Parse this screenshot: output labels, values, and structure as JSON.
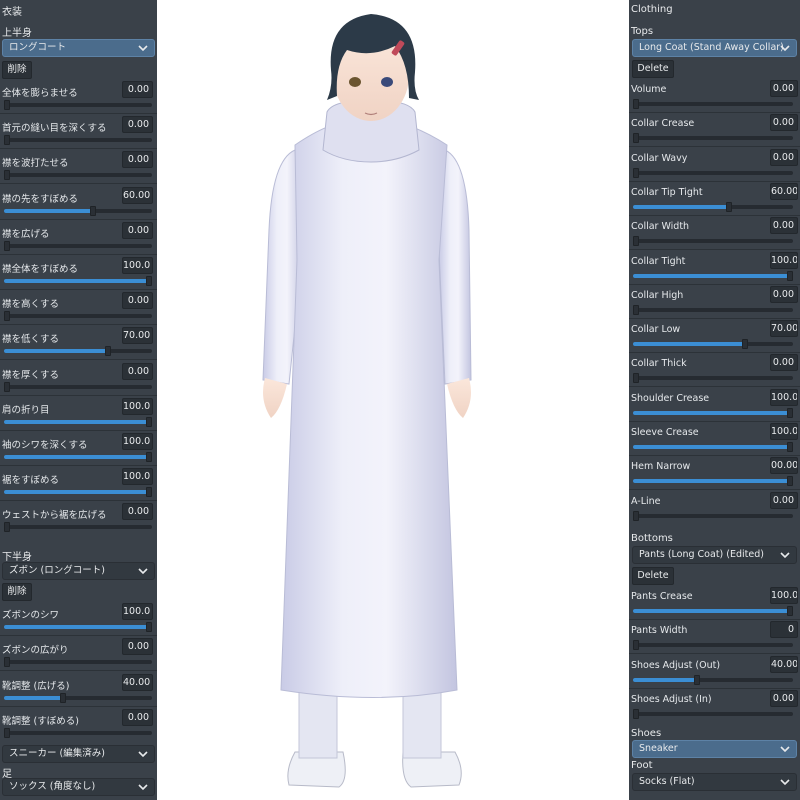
{
  "left": {
    "header": "衣装",
    "tops_label": "上半身",
    "tops_dropdown": "ロングコート",
    "delete_label": "削除",
    "top_sliders": [
      {
        "label": "全体を膨らませる",
        "value": "0.00",
        "fraction": 0
      },
      {
        "label": "首元の縫い目を深くする",
        "value": "0.00",
        "fraction": 0
      },
      {
        "label": "襟を波打たせる",
        "value": "0.00",
        "fraction": 0
      },
      {
        "label": "襟の先をすぼめる",
        "value": "60.00",
        "fraction": 0.6
      },
      {
        "label": "襟を広げる",
        "value": "0.00",
        "fraction": 0
      },
      {
        "label": "襟全体をすぼめる",
        "value": "100.0",
        "fraction": 1
      },
      {
        "label": "襟を高くする",
        "value": "0.00",
        "fraction": 0
      },
      {
        "label": "襟を低くする",
        "value": "70.00",
        "fraction": 0.7
      },
      {
        "label": "襟を厚くする",
        "value": "0.00",
        "fraction": 0
      },
      {
        "label": "肩の折り目",
        "value": "100.0",
        "fraction": 1
      },
      {
        "label": "袖のシワを深くする",
        "value": "100.0",
        "fraction": 1
      },
      {
        "label": "裾をすぼめる",
        "value": "100.0",
        "fraction": 1
      },
      {
        "label": "ウェストから裾を広げる",
        "value": "0.00",
        "fraction": 0
      }
    ],
    "bottoms_label": "下半身",
    "bottoms_dropdown": "ズボン (ロングコート)",
    "bottoms_delete_label": "削除",
    "bottom_sliders": [
      {
        "label": "ズボンのシワ",
        "value": "100.0",
        "fraction": 1
      },
      {
        "label": "ズボンの広がり",
        "value": "0.00",
        "fraction": 0
      },
      {
        "label": "靴調整 (広げる)",
        "value": "40.00",
        "fraction": 0.4
      },
      {
        "label": "靴調整 (すぼめる)",
        "value": "0.00",
        "fraction": 0
      }
    ],
    "shoes_dropdown": "スニーカー (編集済み)",
    "foot_label": "足",
    "foot_dropdown": "ソックス (角度なし)"
  },
  "right": {
    "header": "Clothing",
    "tops_label": "Tops",
    "tops_dropdown": "Long Coat (Stand Away Collar)",
    "delete_label": "Delete",
    "top_sliders": [
      {
        "label": "Volume",
        "value": "0.00",
        "fraction": 0
      },
      {
        "label": "Collar Crease",
        "value": "0.00",
        "fraction": 0
      },
      {
        "label": "Collar Wavy",
        "value": "0.00",
        "fraction": 0
      },
      {
        "label": "Collar Tip Tight",
        "value": "60.00",
        "fraction": 0.6
      },
      {
        "label": "Collar Width",
        "value": "0.00",
        "fraction": 0
      },
      {
        "label": "Collar Tight",
        "value": "100.0",
        "fraction": 1
      },
      {
        "label": "Collar High",
        "value": "0.00",
        "fraction": 0
      },
      {
        "label": "Collar Low",
        "value": "70.00",
        "fraction": 0.7
      },
      {
        "label": "Collar Thick",
        "value": "0.00",
        "fraction": 0
      },
      {
        "label": "Shoulder Crease",
        "value": "100.0",
        "fraction": 1
      },
      {
        "label": "Sleeve Crease",
        "value": "100.0",
        "fraction": 1
      },
      {
        "label": "Hem Narrow",
        "value": "00.00",
        "fraction": 1
      },
      {
        "label": "A-Line",
        "value": "0.00",
        "fraction": 0
      }
    ],
    "bottoms_label": "Bottoms",
    "bottoms_dropdown": "Pants (Long Coat) (Edited)",
    "bottoms_delete_label": "Delete",
    "bottom_sliders": [
      {
        "label": "Pants Crease",
        "value": "100.0",
        "fraction": 1
      },
      {
        "label": "Pants Width",
        "value": "0",
        "fraction": 0
      },
      {
        "label": "Shoes Adjust (Out)",
        "value": "40.00",
        "fraction": 0.4
      },
      {
        "label": "Shoes Adjust (In)",
        "value": "0.00",
        "fraction": 0
      }
    ],
    "shoes_label": "Shoes",
    "shoes_dropdown": "Sneaker",
    "foot_label": "Foot",
    "foot_dropdown": "Socks (Flat)"
  },
  "colors": {
    "panel": "#3a4149",
    "accent": "#3b8ed4",
    "dropdown_active": "#4b6c8c",
    "viewport": "#ffffff"
  }
}
